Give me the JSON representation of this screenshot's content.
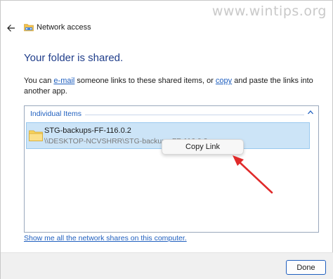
{
  "watermark": "www.wintips.org",
  "window": {
    "title": "Network access",
    "back_icon": "back-arrow-icon",
    "app_icon": "network-folder-icon"
  },
  "heading": "Your folder is shared.",
  "description": {
    "part1": "You can ",
    "email_link": "e-mail",
    "part2": " someone links to these shared items, or ",
    "copy_link": "copy",
    "part3": " and paste the links into another app."
  },
  "items": {
    "group_header": "Individual Items",
    "collapse_icon": "chevron-up-icon",
    "rows": [
      {
        "name": "STG-backups-FF-116.0.2",
        "path": "\\\\DESKTOP-NCVSHRR\\STG-backups-FF-116.0.2",
        "icon": "folder-icon"
      }
    ]
  },
  "context_menu": {
    "items": [
      "Copy Link"
    ]
  },
  "footer": {
    "link": "Show me all the network shares on this computer.",
    "done_label": "Done"
  },
  "colors": {
    "accent": "#1f5fbf",
    "heading": "#1f3d8a",
    "selection": "#cce4f7",
    "annotation_arrow": "#e02a2a"
  }
}
